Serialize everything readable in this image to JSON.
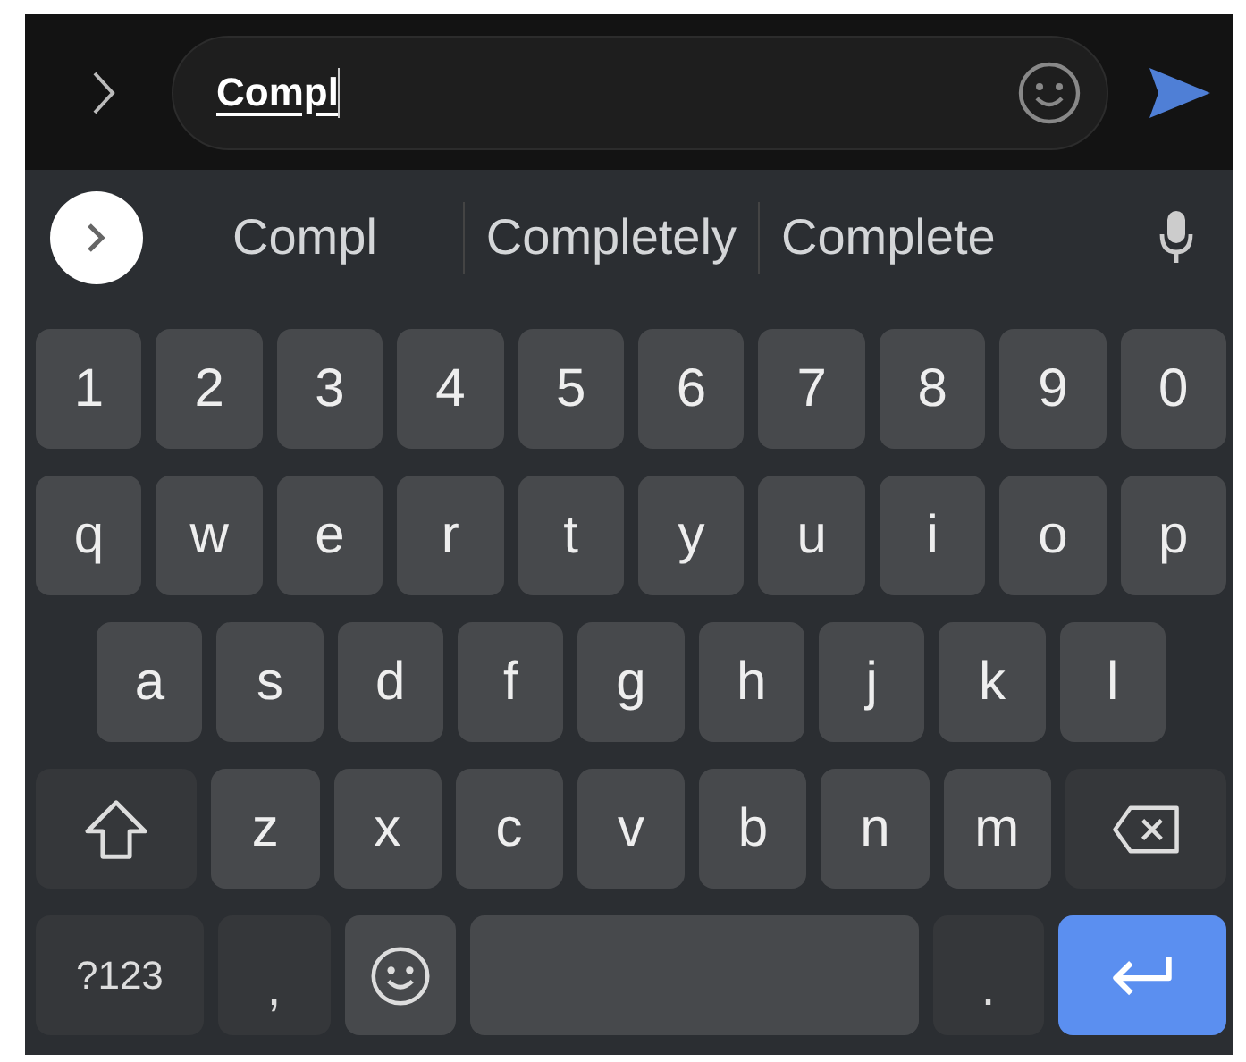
{
  "compose_bar": {
    "message": "Compl"
  },
  "suggestion_strip": {
    "suggestions": [
      "Compl",
      "Completely",
      "Complete"
    ]
  },
  "keyboard": {
    "rows": [
      {
        "kind": "numbers",
        "keys": [
          {
            "kind": "letter",
            "label": "1"
          },
          {
            "kind": "letter",
            "label": "2"
          },
          {
            "kind": "letter",
            "label": "3"
          },
          {
            "kind": "letter",
            "label": "4"
          },
          {
            "kind": "letter",
            "label": "5"
          },
          {
            "kind": "letter",
            "label": "6"
          },
          {
            "kind": "letter",
            "label": "7"
          },
          {
            "kind": "letter",
            "label": "8"
          },
          {
            "kind": "letter",
            "label": "9"
          },
          {
            "kind": "letter",
            "label": "0"
          }
        ]
      },
      {
        "kind": "full",
        "keys": [
          {
            "kind": "letter",
            "label": "q"
          },
          {
            "kind": "letter",
            "label": "w"
          },
          {
            "kind": "letter",
            "label": "e"
          },
          {
            "kind": "letter",
            "label": "r"
          },
          {
            "kind": "letter",
            "label": "t"
          },
          {
            "kind": "letter",
            "label": "y"
          },
          {
            "kind": "letter",
            "label": "u"
          },
          {
            "kind": "letter",
            "label": "i"
          },
          {
            "kind": "letter",
            "label": "o"
          },
          {
            "kind": "letter",
            "label": "p"
          }
        ]
      },
      {
        "kind": "indented",
        "keys": [
          {
            "kind": "letter",
            "label": "a"
          },
          {
            "kind": "letter",
            "label": "s"
          },
          {
            "kind": "letter",
            "label": "d"
          },
          {
            "kind": "letter",
            "label": "f"
          },
          {
            "kind": "letter",
            "label": "g"
          },
          {
            "kind": "letter",
            "label": "h"
          },
          {
            "kind": "letter",
            "label": "j"
          },
          {
            "kind": "letter",
            "label": "k"
          },
          {
            "kind": "letter",
            "label": "l"
          }
        ]
      },
      {
        "kind": "full",
        "keys": [
          {
            "kind": "shift"
          },
          {
            "kind": "letter",
            "label": "z"
          },
          {
            "kind": "letter",
            "label": "x"
          },
          {
            "kind": "letter",
            "label": "c"
          },
          {
            "kind": "letter",
            "label": "v"
          },
          {
            "kind": "letter",
            "label": "b"
          },
          {
            "kind": "letter",
            "label": "n"
          },
          {
            "kind": "letter",
            "label": "m"
          },
          {
            "kind": "backspace"
          }
        ]
      },
      {
        "kind": "full",
        "keys": [
          {
            "kind": "symbols",
            "label": "?123"
          },
          {
            "kind": "punct",
            "label": ","
          },
          {
            "kind": "emoji"
          },
          {
            "kind": "space"
          },
          {
            "kind": "punct",
            "label": "."
          },
          {
            "kind": "enter"
          }
        ]
      }
    ]
  }
}
